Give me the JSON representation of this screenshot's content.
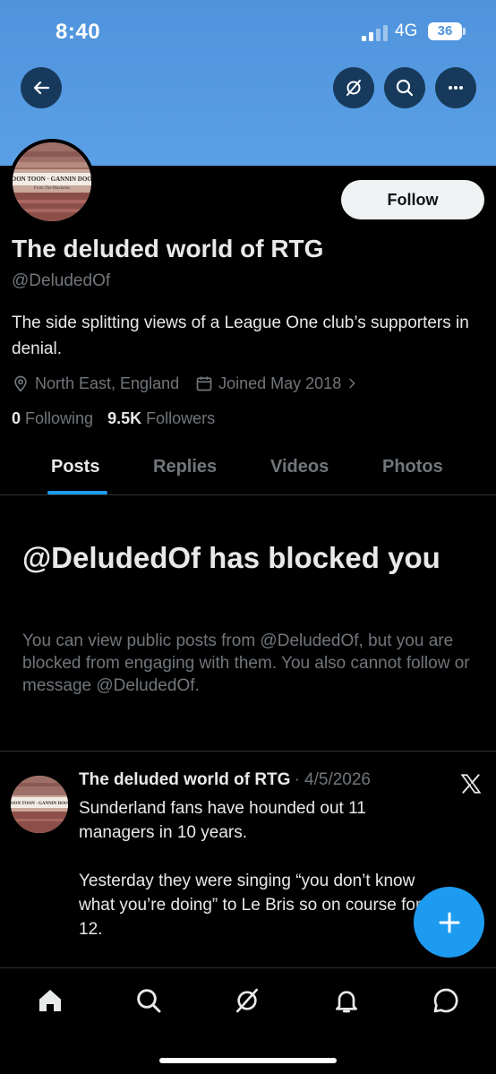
{
  "status_bar": {
    "time": "8:40",
    "network": "4G",
    "battery": "36"
  },
  "profile": {
    "follow_label": "Follow",
    "display_name": "The deluded world of RTG",
    "handle": "@DeludedOf",
    "bio": "The side splitting views of a League One club’s supporters in denial.",
    "location": "North East, England",
    "joined": "Joined May 2018",
    "following_count": "0",
    "following_label": "Following",
    "followers_count": "9.5K",
    "followers_label": "Followers"
  },
  "tabs": [
    {
      "label": "Posts",
      "active": true
    },
    {
      "label": "Replies"
    },
    {
      "label": "Videos"
    },
    {
      "label": "Photos"
    }
  ],
  "blocked": {
    "title": "@DeludedOf has blocked you",
    "text": "You can view public posts from @DeludedOf, but you are blocked from engaging with them. You also cannot follow or message @DeludedOf."
  },
  "post": {
    "author": "The deluded world of RTG",
    "date": "· 4/5/2026",
    "body": "Sunderland fans have hounded out 11 managers in 10 years.\n\nYesterday they were singing “you don’t know what you’re doing” to Le Bris so on course for no 12."
  },
  "avatar_banner_text": "TOON TOON · GANNIN DOON",
  "avatar_banner_subtext": "From The Mackems",
  "icons": {
    "back": "arrow-left-icon",
    "grok": "grok-icon",
    "search": "search-icon",
    "more": "more-icon",
    "compose": "plus-icon",
    "home": "home-icon",
    "notifications": "bell-icon",
    "messages": "message-icon"
  },
  "colors": {
    "accent": "#1d9bf0",
    "banner": "#5aa0e6",
    "muted": "#71767b"
  }
}
